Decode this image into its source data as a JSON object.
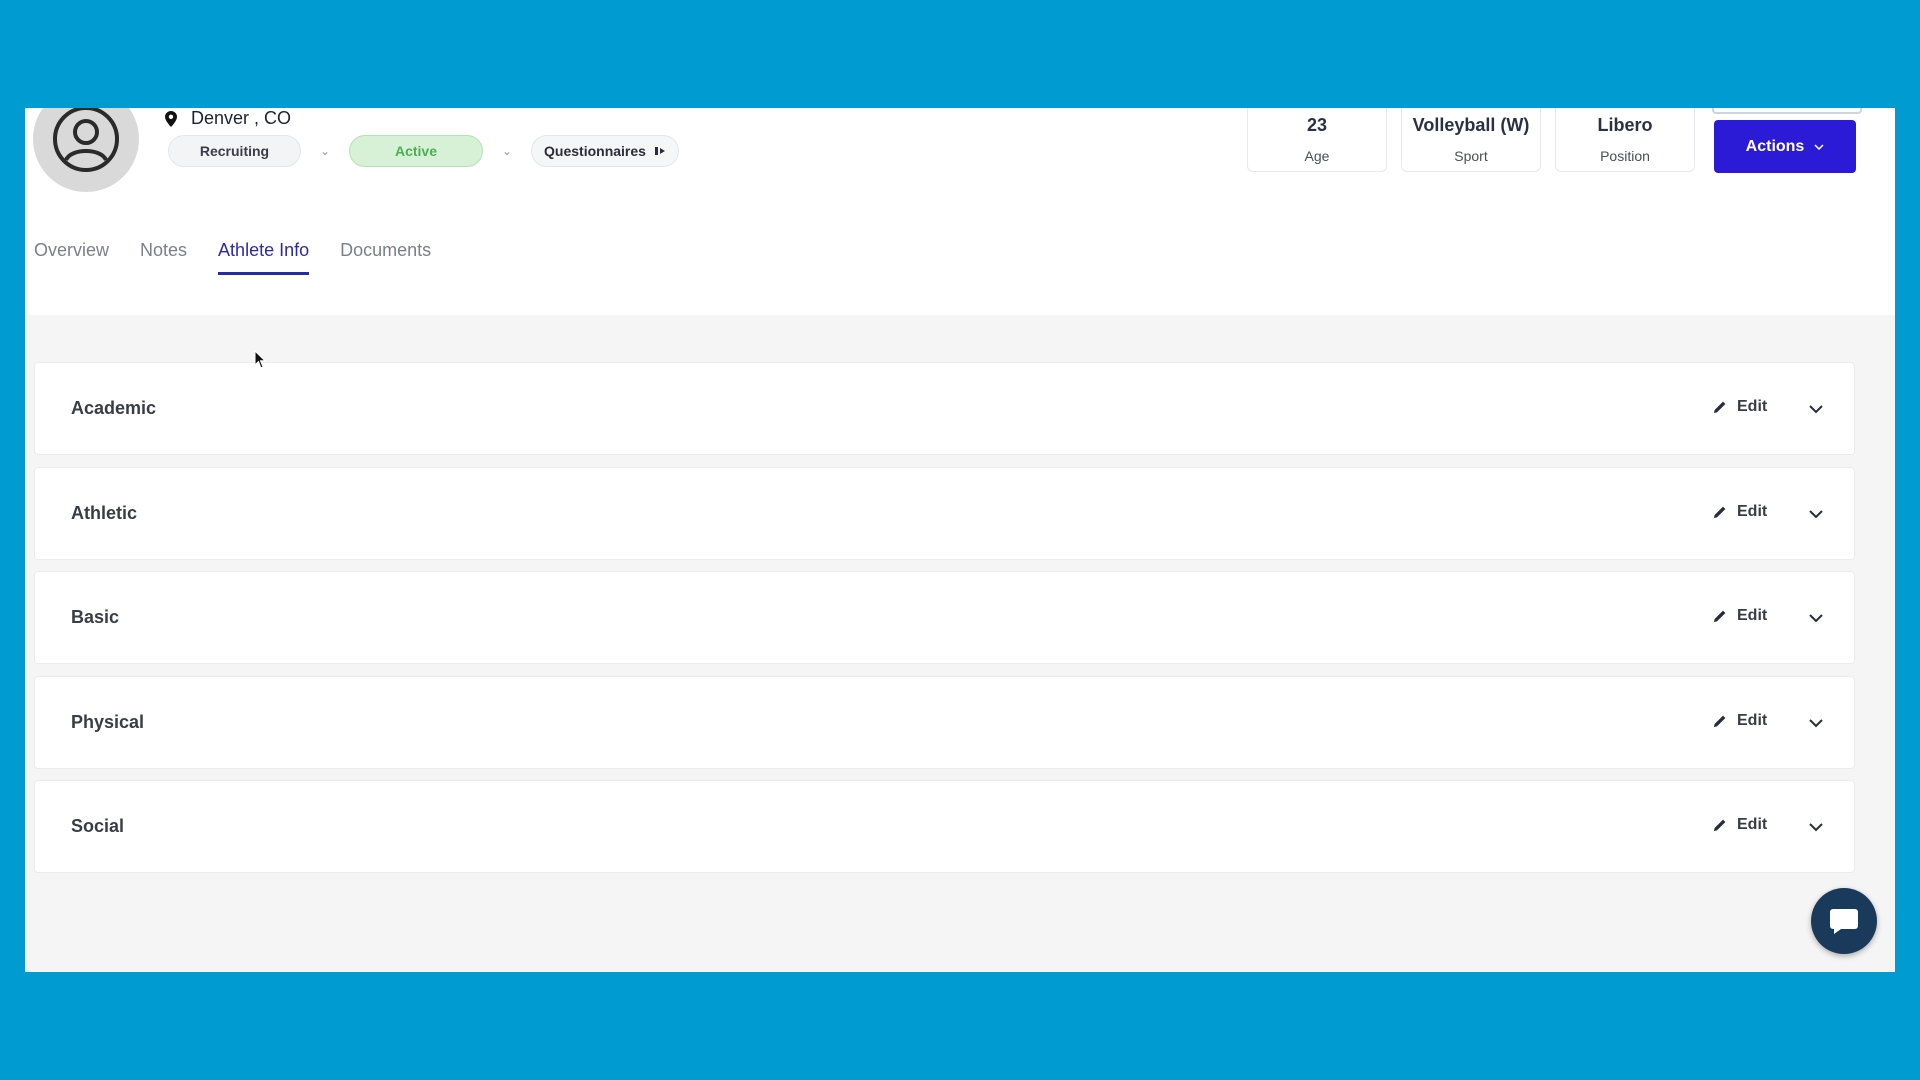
{
  "profile": {
    "location": "Denver , CO",
    "status_pills": {
      "recruiting_label": "Recruiting",
      "active_label": "Active",
      "questionnaires_label": "Questionnaires"
    },
    "stats": [
      {
        "value": "23",
        "label": "Age"
      },
      {
        "value": "Volleyball (W)",
        "label": "Sport"
      },
      {
        "value": "Libero",
        "label": "Position"
      }
    ],
    "actions_label": "Actions"
  },
  "tabs": [
    {
      "label": "Overview",
      "selected": false
    },
    {
      "label": "Notes",
      "selected": false
    },
    {
      "label": "Athlete Info",
      "selected": true
    },
    {
      "label": "Documents",
      "selected": false
    }
  ],
  "sections": [
    {
      "title": "Academic",
      "edit_label": "Edit"
    },
    {
      "title": "Athletic",
      "edit_label": "Edit"
    },
    {
      "title": "Basic",
      "edit_label": "Edit"
    },
    {
      "title": "Physical",
      "edit_label": "Edit"
    },
    {
      "title": "Social",
      "edit_label": "Edit"
    }
  ],
  "colors": {
    "page_background": "#009bd0",
    "accent": "#2c1bd6",
    "active_pill_bg": "#d6f1d6",
    "active_pill_text": "#4cae55",
    "selected_tab": "#2b2aa6"
  }
}
